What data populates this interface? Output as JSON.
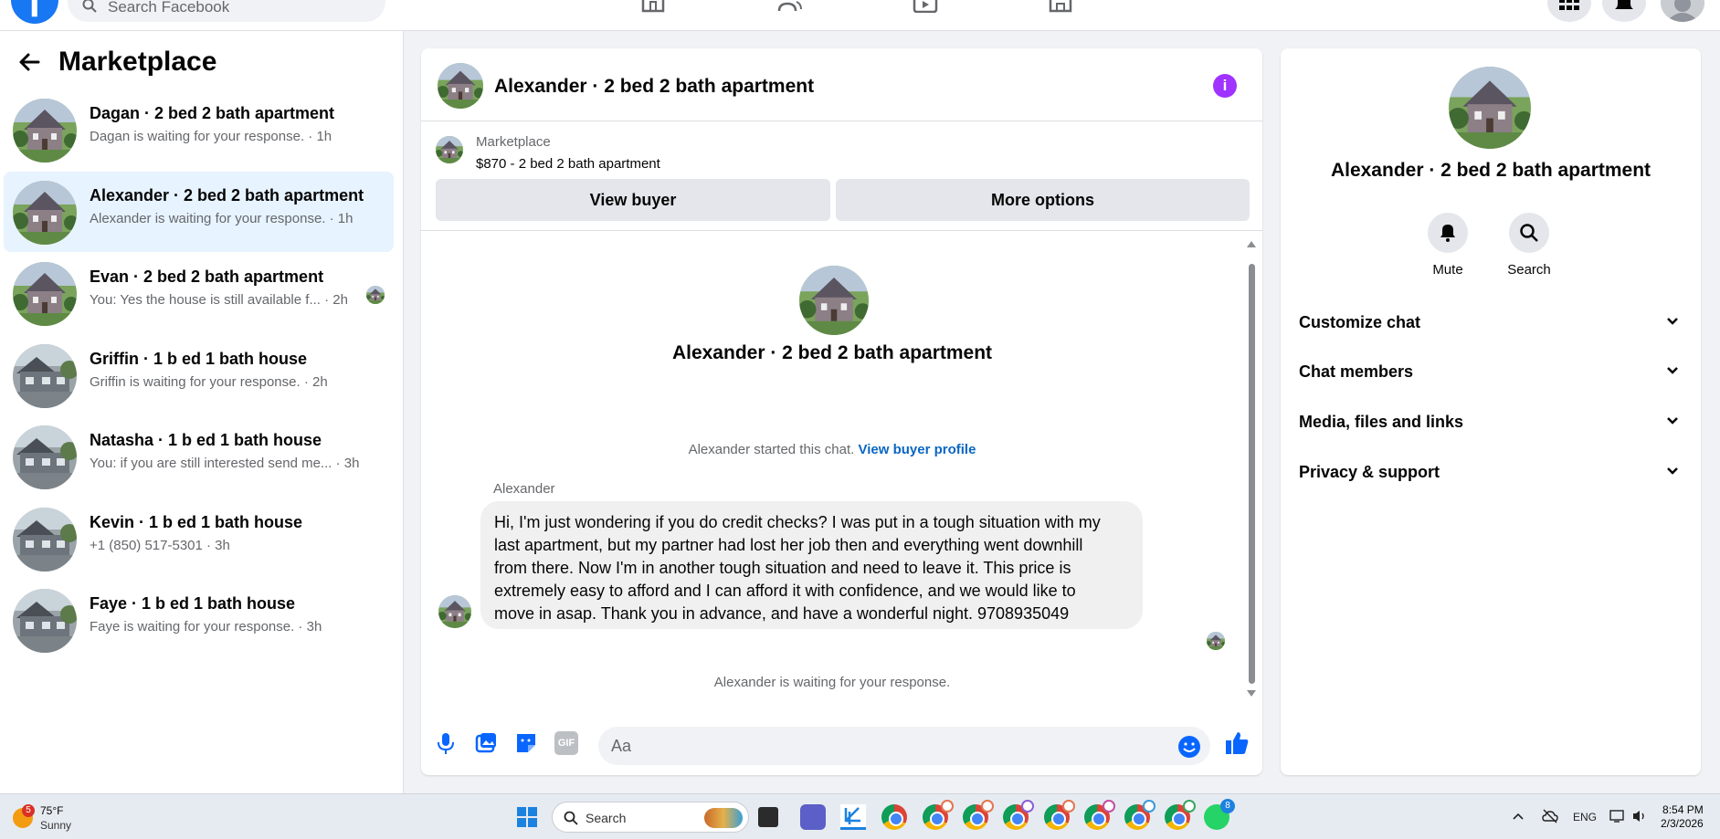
{
  "topnav": {
    "search_placeholder": "Search Facebook",
    "logo_letter": "f",
    "icons": [
      "home-icon",
      "friends-icon",
      "video-icon",
      "marketplace-icon",
      "menu-grid-icon",
      "bell-icon",
      "profile-avatar"
    ]
  },
  "left": {
    "title": "Marketplace",
    "conversations": [
      {
        "name": "Dagan · 2 bed 2 bath apartment",
        "preview": "Dagan is waiting for your response. · 1h",
        "thumb": "house",
        "active": false
      },
      {
        "name": "Alexander · 2 bed 2 bath apartment",
        "preview": "Alexander is waiting for your response. · 1h",
        "thumb": "house",
        "active": true
      },
      {
        "name": "Evan · 2 bed 2 bath apartment",
        "preview": "You: Yes the house is still available f... · 2h",
        "thumb": "house",
        "active": false,
        "seen": true
      },
      {
        "name": "Griffin · 1 b ed 1 bath house",
        "preview": "Griffin is waiting for your response. · 2h",
        "thumb": "house2",
        "active": false
      },
      {
        "name": "Natasha · 1 b ed 1 bath house",
        "preview": "You: if you are still interested send me... · 3h",
        "thumb": "house2",
        "active": false
      },
      {
        "name": "Kevin · 1 b ed 1 bath house",
        "preview": "+1 (850) 517-5301 · 3h",
        "thumb": "house2",
        "active": false
      },
      {
        "name": "Faye · 1 b ed 1 bath house",
        "preview": "Faye is waiting for your response. · 3h",
        "thumb": "house2",
        "active": false
      }
    ]
  },
  "chat": {
    "title": "Alexander · 2 bed 2 bath apartment",
    "info_icon": "i",
    "banner": {
      "source": "Marketplace",
      "listing": "$870 - 2 bed 2 bath apartment",
      "view_buyer": "View buyer",
      "more_options": "More options"
    },
    "intro_name": "Alexander · 2 bed 2 bath apartment",
    "started_text": "Alexander started this chat.",
    "view_profile_link": "View buyer profile",
    "sender": "Alexander",
    "lines": [
      "Hi, I'm just wondering if you do credit checks? I was put in a tough situation with my",
      "last apartment, but my partner had lost her job then and everything went downhill",
      "from there. Now I'm in another tough situation and need to leave it. This price is",
      "extremely easy to afford and I can afford it with confidence, and we would like to",
      "move in asap. Thank you in advance, and have a wonderful night. 9708935049"
    ],
    "waiting": "Alexander is waiting for your response.",
    "compose_placeholder": "Aa",
    "gif_label": "GIF"
  },
  "right": {
    "name": "Alexander · 2 bed 2 bath apartment",
    "mute": "Mute",
    "search": "Search",
    "sections": [
      "Customize chat",
      "Chat members",
      "Media, files and links",
      "Privacy & support"
    ]
  },
  "taskbar": {
    "weather_temp": "75°F",
    "weather_cond": "Sunny",
    "weather_badge": "5",
    "search": "Search",
    "lang": "ENG",
    "time": "8:54 PM",
    "date": "2/3/2026",
    "whatsapp_badge": "8"
  }
}
